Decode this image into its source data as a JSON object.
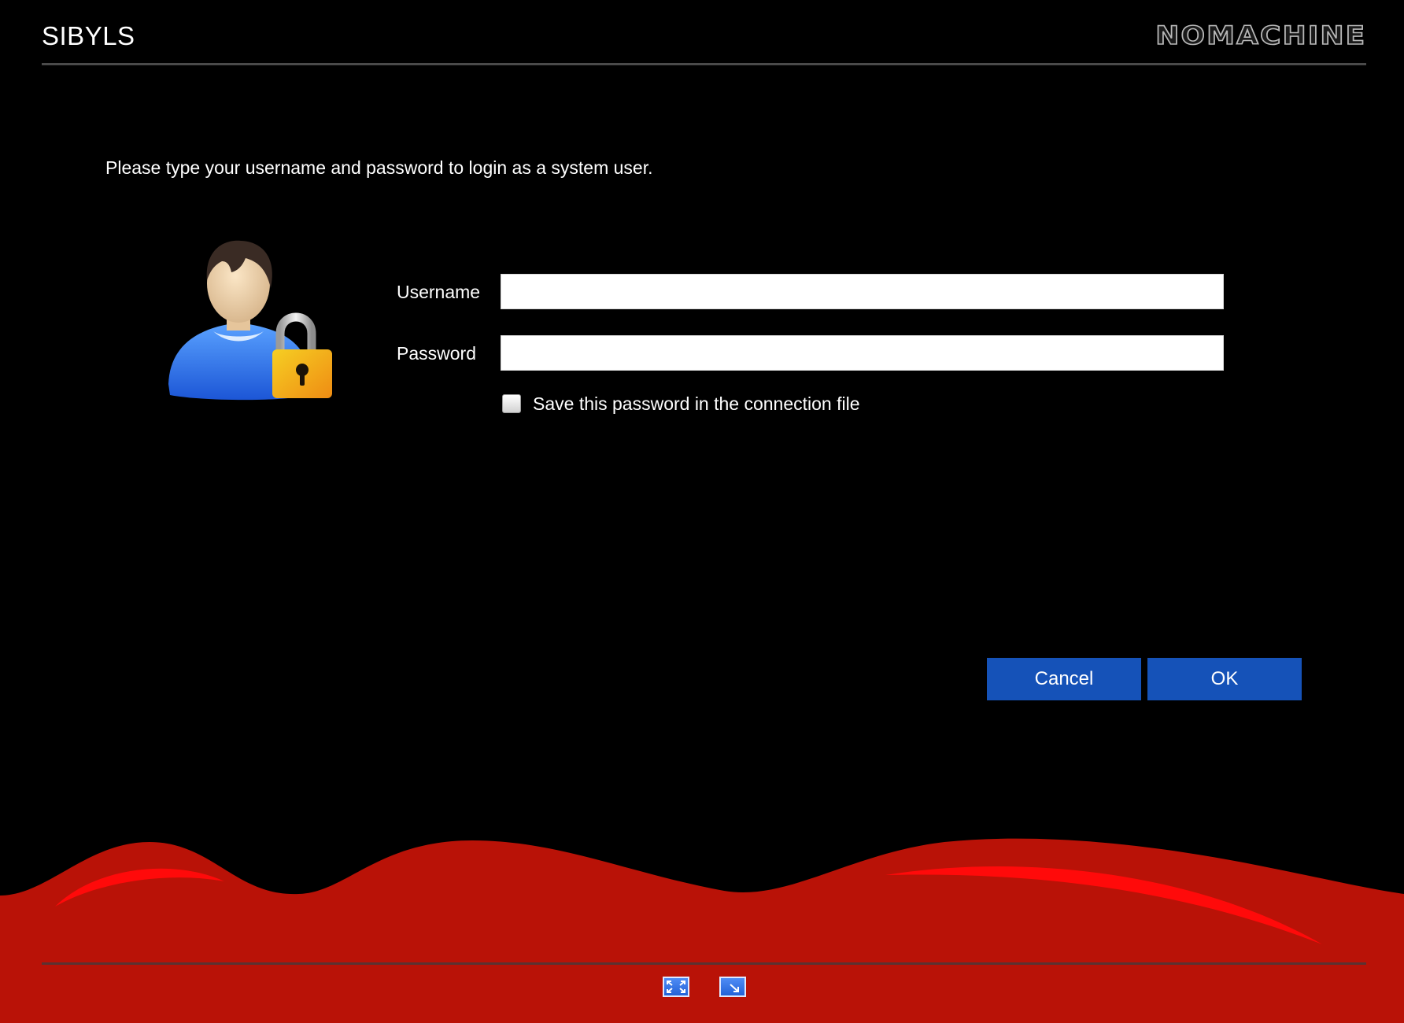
{
  "header": {
    "title": "SIBYLS",
    "brand": "NOMACHINE"
  },
  "login": {
    "prompt": "Please type your username and password to login as a system user.",
    "username_label": "Username",
    "username_value": "",
    "password_label": "Password",
    "password_value": "",
    "save_password_label": "Save this password in the connection file",
    "save_password_checked": false
  },
  "buttons": {
    "cancel_label": "Cancel",
    "ok_label": "OK"
  },
  "footer": {
    "controls": [
      {
        "icon": "fit-to-window-icon"
      },
      {
        "icon": "scale-display-icon"
      }
    ]
  },
  "colors": {
    "background": "#000000",
    "accent_red": "#b91207",
    "button_blue": "#1552b8"
  }
}
